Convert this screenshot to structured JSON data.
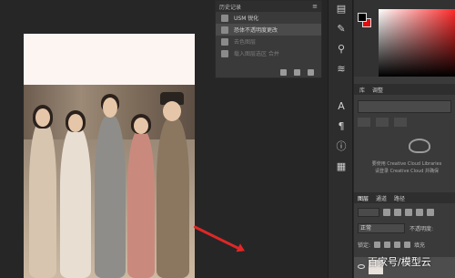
{
  "history_panel": {
    "tab_label": "历史记录",
    "items": [
      {
        "label": "USM 锐化",
        "state": "normal"
      },
      {
        "label": "恐体不透明度更改",
        "state": "selected"
      },
      {
        "label": "去色图层",
        "state": "dim"
      },
      {
        "label": "载入图层选区 合并",
        "state": "dim"
      }
    ]
  },
  "libraries_panel": {
    "tabs": [
      "库",
      "调整"
    ],
    "cc_text_line1": "要使用 Creative Cloud Libraries",
    "cc_text_line2": "请登录 Creative Cloud 并确保"
  },
  "layers_panel": {
    "tabs": [
      "图层",
      "通道",
      "路径"
    ],
    "blend_mode": "正常",
    "opacity_label": "不透明度:",
    "lock_label": "锁定:",
    "fill_label": "填充"
  },
  "watermark": "百家号/模型云",
  "colors": {
    "foreground": "#000000",
    "background": "#e20d0d",
    "arrow": "#e02727"
  }
}
